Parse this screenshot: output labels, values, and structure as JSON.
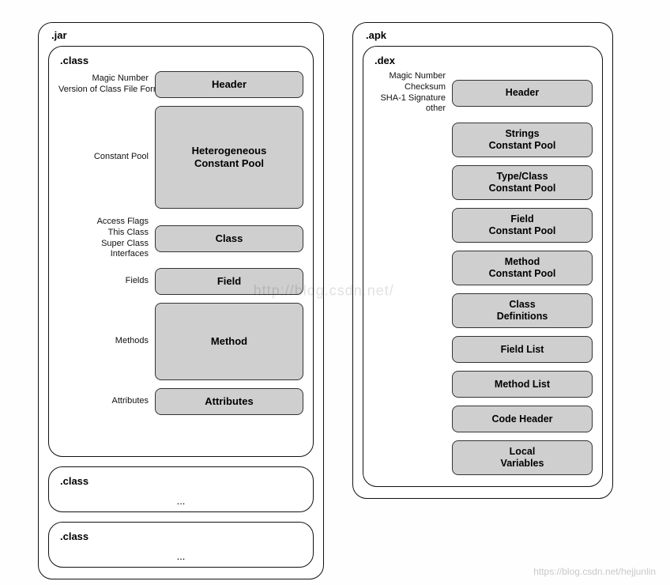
{
  "jar": {
    "title": ".jar",
    "class_main": {
      "title": ".class",
      "rows": [
        {
          "labels": [
            "Magic Number",
            "Version of Class File Format"
          ],
          "block": "Header",
          "size": "h-xs"
        },
        {
          "labels": [
            "Constant Pool"
          ],
          "block": "Heterogeneous\nConstant Pool",
          "size": "h-xl"
        },
        {
          "labels": [
            "Access Flags",
            "This Class",
            "Super Class",
            "Interfaces"
          ],
          "block": "Class",
          "size": "h-xs"
        },
        {
          "labels": [
            "Fields"
          ],
          "block": "Field",
          "size": "h-xs"
        },
        {
          "labels": [
            "Methods"
          ],
          "block": "Method",
          "size": "h-l"
        },
        {
          "labels": [
            "Attributes"
          ],
          "block": "Attributes",
          "size": "h-xs"
        }
      ]
    },
    "class_extra": [
      {
        "title": ".class",
        "ellipsis": "..."
      },
      {
        "title": ".class",
        "ellipsis": "..."
      }
    ]
  },
  "apk": {
    "title": ".apk",
    "dex": {
      "title": ".dex",
      "rows": [
        {
          "labels": [
            "Magic Number",
            "Checksum",
            "SHA-1 Signature",
            "other"
          ],
          "block": "Header",
          "size": "h-xs"
        },
        {
          "labels": [],
          "block": "Strings\nConstant Pool",
          "size": "h-s"
        },
        {
          "labels": [],
          "block": "Type/Class\nConstant Pool",
          "size": "h-s"
        },
        {
          "labels": [],
          "block": "Field\nConstant Pool",
          "size": "h-s"
        },
        {
          "labels": [],
          "block": "Method\nConstant Pool",
          "size": "h-s"
        },
        {
          "labels": [],
          "block": "Class\nDefinitions",
          "size": "h-s"
        },
        {
          "labels": [],
          "block": "Field List",
          "size": "h-xs"
        },
        {
          "labels": [],
          "block": "Method List",
          "size": "h-xs"
        },
        {
          "labels": [],
          "block": "Code Header",
          "size": "h-xs"
        },
        {
          "labels": [],
          "block": "Local\nVariables",
          "size": "h-s"
        }
      ]
    }
  },
  "watermark_center": "http://blog.csdn.net/",
  "watermark_corner": "https://blog.csdn.net/hejjunlin"
}
